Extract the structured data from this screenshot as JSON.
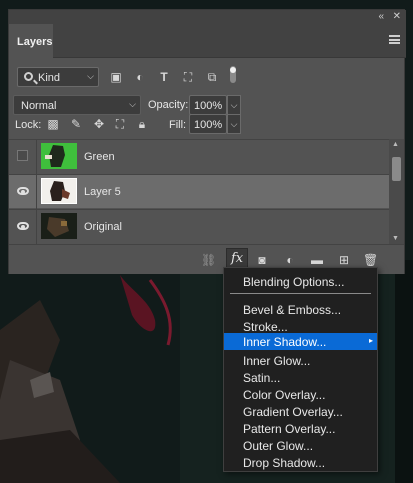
{
  "panel": {
    "tab_label": "Layers",
    "collapse_icon": "double-chevron-icon",
    "close_icon": "close-icon",
    "menu_icon": "panel-menu-icon"
  },
  "filter": {
    "kind_label": "Kind",
    "icons": [
      "image-filter-icon",
      "adjustment-filter-icon",
      "type-filter-icon",
      "shape-filter-icon",
      "smart-object-filter-icon",
      "filter-toggle-icon"
    ]
  },
  "blend": {
    "mode": "Normal",
    "opacity_label": "Opacity:",
    "opacity_value": "100%"
  },
  "lock": {
    "label": "Lock:",
    "icons": [
      "lock-transparent-icon",
      "lock-brush-icon",
      "lock-move-icon",
      "lock-artboard-icon",
      "lock-all-icon"
    ],
    "fill_label": "Fill:",
    "fill_value": "100%"
  },
  "layers": [
    {
      "name": "Green",
      "visible": false,
      "selected": false
    },
    {
      "name": "Layer 5",
      "visible": true,
      "selected": true
    },
    {
      "name": "Original",
      "visible": true,
      "selected": false
    }
  ],
  "toolbar": {
    "fx_label": "fx",
    "icons": [
      "link-layers-icon",
      "fx-icon",
      "add-mask-icon",
      "adjustment-layer-icon",
      "new-group-icon",
      "new-layer-icon",
      "trash-icon"
    ]
  },
  "fx_menu": {
    "top_item": "Blending Options...",
    "items": [
      "Bevel & Emboss...",
      "Stroke...",
      "Inner Shadow...",
      "Inner Glow...",
      "Satin...",
      "Color Overlay...",
      "Gradient Overlay...",
      "Pattern Overlay...",
      "Outer Glow...",
      "Drop Shadow..."
    ],
    "highlighted": "Inner Shadow..."
  },
  "colors": {
    "panel": "#535353",
    "menu_bg": "#202020",
    "highlight": "#0a6ad6"
  }
}
